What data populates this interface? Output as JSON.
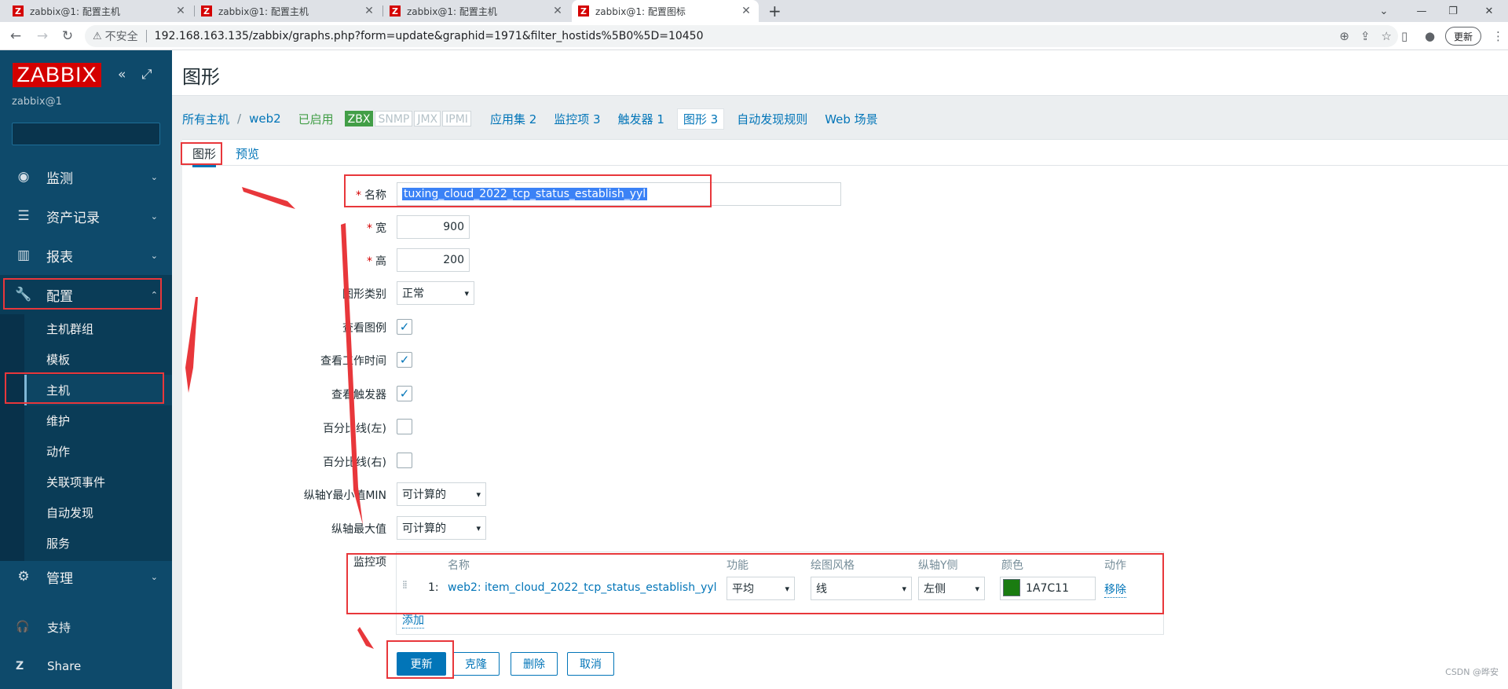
{
  "browser": {
    "tabs": [
      {
        "title": "zabbix@1: 配置主机"
      },
      {
        "title": "zabbix@1: 配置主机"
      },
      {
        "title": "zabbix@1: 配置主机"
      },
      {
        "title": "zabbix@1: 配置图标"
      }
    ],
    "favicon_letter": "Z",
    "security_label": "不安全",
    "url": "192.168.163.135/zabbix/graphs.php?form=update&graphid=1971&filter_hostids%5B0%5D=10450",
    "update_label": "更新"
  },
  "sidebar": {
    "logo": "ZABBIX",
    "user": "zabbix@1",
    "search_value": "",
    "menu": [
      {
        "label": "监测",
        "icon": "eye-icon"
      },
      {
        "label": "资产记录",
        "icon": "list-icon"
      },
      {
        "label": "报表",
        "icon": "bar-chart-icon"
      },
      {
        "label": "配置",
        "icon": "wrench-icon"
      },
      {
        "label": "管理",
        "icon": "gear-icon"
      }
    ],
    "submenu": [
      "主机群组",
      "模板",
      "主机",
      "维护",
      "动作",
      "关联项事件",
      "自动发现",
      "服务"
    ],
    "support": "支持",
    "share": "Share"
  },
  "page": {
    "title": "图形"
  },
  "host_nav": {
    "all_hosts": "所有主机",
    "host": "web2",
    "status": "已启用",
    "badges": [
      "ZBX",
      "SNMP",
      "JMX",
      "IPMI"
    ],
    "apps": "应用集 2",
    "items": "监控项 3",
    "triggers": "触发器 1",
    "graphs": "图形 3",
    "discovery": "自动发现规则",
    "web": "Web 场景"
  },
  "subtabs": {
    "graph": "图形",
    "preview": "预览"
  },
  "form": {
    "name_label": "名称",
    "name_value": "tuxing_cloud_2022_tcp_status_establish_yyl",
    "width_label": "宽",
    "width_value": "900",
    "height_label": "高",
    "height_value": "200",
    "type_label": "图形类别",
    "type_value": "正常",
    "legend_label": "查看图例",
    "worktime_label": "查看工作时间",
    "triggers_label": "查看触发器",
    "pct_left_label": "百分比线(左)",
    "pct_right_label": "百分比线(右)",
    "ymin_label": "纵轴Y最小值MIN",
    "ymin_value": "可计算的",
    "ymax_label": "纵轴最大值",
    "ymax_value": "可计算的",
    "items_label": "监控项",
    "checks": {
      "legend": true,
      "worktime": true,
      "triggers": true,
      "pct_left": false,
      "pct_right": false
    }
  },
  "items_table": {
    "headers": {
      "name": "名称",
      "function": "功能",
      "drawstyle": "绘图风格",
      "yaxis": "纵轴Y侧",
      "color": "颜色",
      "action": "动作"
    },
    "rows": [
      {
        "num": "1:",
        "name": "web2: item_cloud_2022_tcp_status_establish_yyl",
        "function": "平均",
        "drawstyle": "线",
        "yaxis": "左侧",
        "color": "1A7C11",
        "color_hex": "#1A7C11",
        "remove": "移除"
      }
    ],
    "add": "添加"
  },
  "buttons": {
    "update": "更新",
    "clone": "克隆",
    "delete": "删除",
    "cancel": "取消"
  },
  "watermark": "CSDN @晔安",
  "colors": {
    "sidebar_bg": "#0E4A6B",
    "accent": "#0275B8",
    "brand": "#D40000",
    "highlight": "#E8373B",
    "enabled": "#429E47"
  }
}
